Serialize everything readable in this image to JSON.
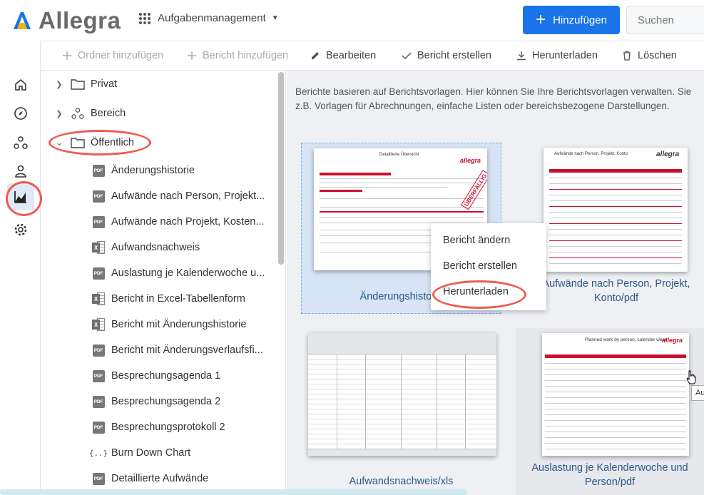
{
  "app": {
    "brand": "Allegra",
    "module": "Aufgabenmanagement"
  },
  "header": {
    "add_label": "Hinzufügen",
    "search_placeholder": "Suchen"
  },
  "toolbar": {
    "add_folder": "Ordner hinzufügen",
    "add_report": "Bericht hinzufügen",
    "edit": "Bearbeiten",
    "create_report": "Bericht erstellen",
    "download": "Herunterladen",
    "delete": "Löschen"
  },
  "tree": {
    "roots": [
      {
        "label": "Privat",
        "icon": "folder-icon",
        "expanded": false
      },
      {
        "label": "Bereich",
        "icon": "nodes-icon",
        "expanded": false
      },
      {
        "label": "Öffentlich",
        "icon": "folder-icon",
        "expanded": true
      }
    ],
    "children": [
      {
        "label": "Änderungshistorie",
        "type": "pdf"
      },
      {
        "label": "Aufwände nach Person, Projekt...",
        "type": "pdf"
      },
      {
        "label": "Aufwände nach Projekt, Kosten...",
        "type": "pdf"
      },
      {
        "label": "Aufwandsnachweis",
        "type": "xls"
      },
      {
        "label": "Auslastung je Kalenderwoche u...",
        "type": "pdf"
      },
      {
        "label": "Bericht in Excel-Tabellenform",
        "type": "xls"
      },
      {
        "label": "Bericht mit Änderungshistorie",
        "type": "xls"
      },
      {
        "label": "Bericht mit Änderungsverlaufsfi...",
        "type": "pdf"
      },
      {
        "label": "Besprechungsagenda 1",
        "type": "pdf"
      },
      {
        "label": "Besprechungsagenda 2",
        "type": "pdf"
      },
      {
        "label": "Besprechungsprotokoll 2",
        "type": "pdf"
      },
      {
        "label": "Burn Down Chart",
        "type": "json"
      },
      {
        "label": "Detaillierte Aufwände",
        "type": "pdf"
      }
    ],
    "pdf_badge": "PDF"
  },
  "content": {
    "info": "Berichte basieren auf Berichtsvorlagen. Hier können Sie Ihre Berichtsvorlagen verwalten. Sie z.B. Vorlagen für Abrechnungen, einfache Listen oder bereichsbezogene Darstellungen.",
    "cards": [
      {
        "label": "Änderungshistorie"
      },
      {
        "label": "Aufwände nach Person, Projekt, Konto/pdf"
      },
      {
        "label": "Aufwandsnachweis/xls"
      },
      {
        "label": "Auslastung je Kalenderwoche und Person/pdf"
      }
    ],
    "thumb_texts": {
      "doc1_title": "Detaillierte Übersicht",
      "doc1_logo": "allegra",
      "doc1_stamp": "ÜBERFÄLLIG",
      "doc2_title": "Aufwände nach Person, Projekt, Konto",
      "doc2_logo": "allegra",
      "doc4_title": "Planned work by person, calendar week",
      "doc4_logo": "allegra"
    }
  },
  "context_menu": {
    "items": [
      "Bericht ändern",
      "Bericht erstellen",
      "Herunterladen"
    ]
  },
  "tooltip": "Au",
  "colors": {
    "accent": "#1a73e8",
    "highlight": "#f05b4f",
    "brand_red": "#c8102e"
  }
}
